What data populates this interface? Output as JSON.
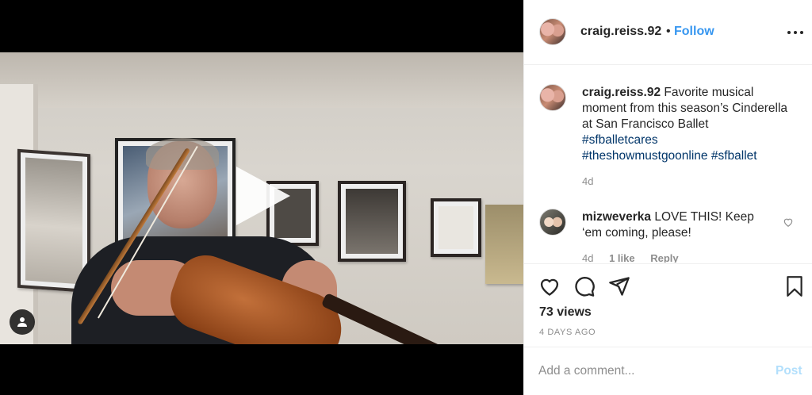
{
  "post": {
    "username": "craig.reiss.92",
    "separator": "•",
    "follow_label": "Follow",
    "more_icon": "more-horizontal-icon"
  },
  "caption": {
    "username": "craig.reiss.92",
    "text": "Favorite musical moment from this season’s Cinderella at San Francisco Ballet",
    "hashtags": [
      "#sfballetcares",
      "#theshowmustgoonline",
      "#sfballet"
    ],
    "time": "4d"
  },
  "comments": [
    {
      "username": "mizweverka",
      "text": "LOVE THIS! Keep ‘em coming, please!",
      "time": "4d",
      "likes": "1 like",
      "reply_label": "Reply"
    }
  ],
  "actions": {
    "icons": [
      "heart-icon",
      "comment-icon",
      "share-icon",
      "bookmark-icon"
    ],
    "views": "73 views",
    "date": "4 DAYS AGO"
  },
  "composer": {
    "placeholder": "Add a comment...",
    "post_label": "Post",
    "post_color": "#b2dffc"
  },
  "colors": {
    "accent": "#3897f0",
    "hashtag": "#003569",
    "text": "#262626",
    "muted": "#8e8e8e"
  }
}
